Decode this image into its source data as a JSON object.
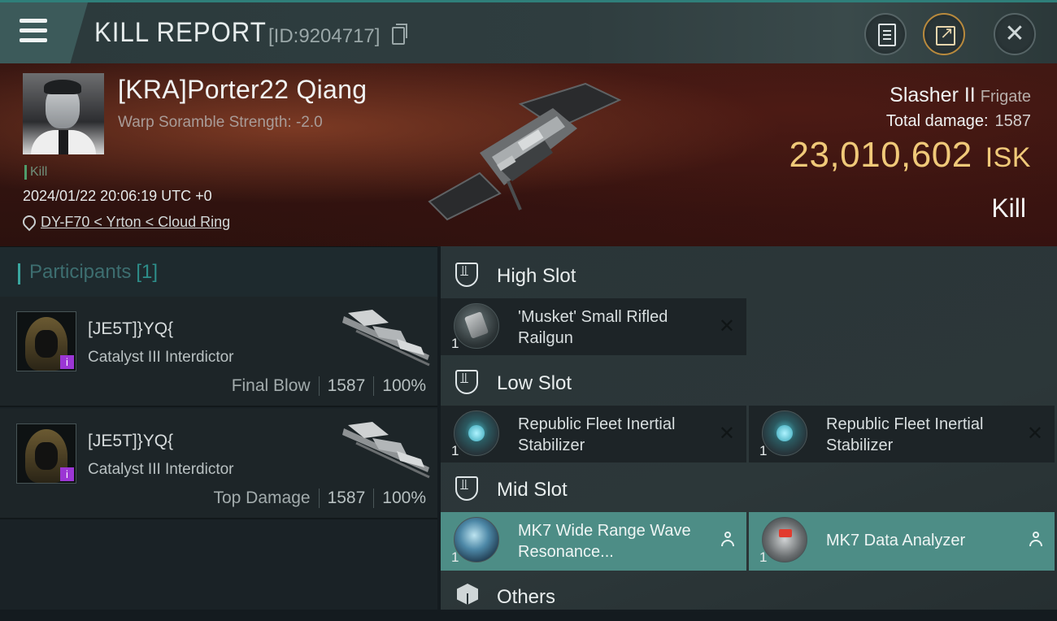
{
  "header": {
    "title": "KILL REPORT",
    "kill_id": "[ID:9204717]"
  },
  "victim": {
    "name": "[KRA]Porter22 Qiang",
    "scramble": "Warp Soramble Strength: -2.0",
    "tag": "Kill",
    "time": "2024/01/22 20:06:19 UTC +0",
    "location": "DY-F70 < Yrton < Cloud Ring",
    "ship": "Slasher II",
    "ship_class": "Frigate",
    "total_damage_label": "Total damage:",
    "total_damage": "1587",
    "isk_value": "23,010,602",
    "isk_unit": "ISK",
    "result": "Kill"
  },
  "participants": {
    "title": "Participants",
    "count": "[1]",
    "rows": [
      {
        "name": "[JE5T]}YQ{",
        "ship": "Catalyst III Interdictor",
        "label": "Final Blow",
        "damage": "1587",
        "percent": "100%",
        "badge": "i"
      },
      {
        "name": "[JE5T]}YQ{",
        "ship": "Catalyst III Interdictor",
        "label": "Top Damage",
        "damage": "1587",
        "percent": "100%",
        "badge": "i"
      }
    ]
  },
  "slots": {
    "high": {
      "title": "High Slot",
      "items": [
        {
          "name": "'Musket' Small Rifled Railgun",
          "qty": "1",
          "icon": "railgun-icon",
          "status": "destroyed"
        }
      ]
    },
    "low": {
      "title": "Low Slot",
      "items": [
        {
          "name": "Republic Fleet Inertial Stabilizer",
          "qty": "1",
          "icon": "inertial-stabilizer-icon",
          "status": "destroyed"
        },
        {
          "name": "Republic Fleet Inertial Stabilizer",
          "qty": "1",
          "icon": "inertial-stabilizer-icon",
          "status": "destroyed"
        }
      ]
    },
    "mid": {
      "title": "Mid Slot",
      "items": [
        {
          "name": "MK7 Wide Range Wave Resonance...",
          "qty": "1",
          "icon": "wave-resonance-icon",
          "status": "dropped"
        },
        {
          "name": "MK7 Data Analyzer",
          "qty": "1",
          "icon": "data-analyzer-icon",
          "status": "dropped"
        }
      ]
    },
    "others": {
      "title": "Others"
    }
  },
  "colors": {
    "accent_teal": "#3aa7a0",
    "isk_gold": "#f0c979",
    "dropped_bg": "#4d8d86",
    "drone_badge": "#9b36d4"
  }
}
